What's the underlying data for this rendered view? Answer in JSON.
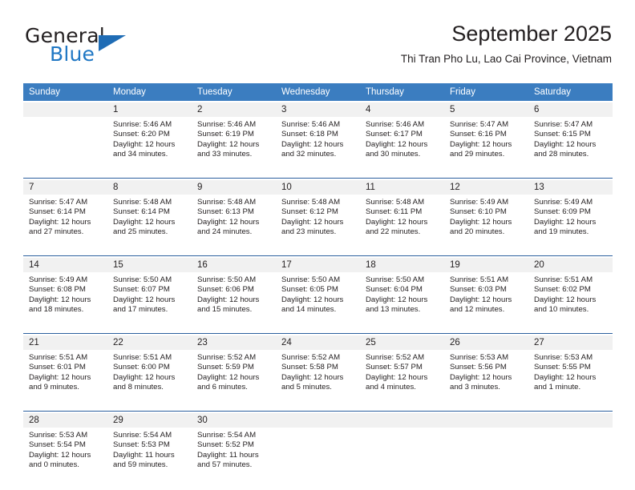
{
  "brand": {
    "name_top": "General",
    "name_bottom": "Blue",
    "triangle_color": "#1f6cb5",
    "blue_color": "#1f77c4"
  },
  "header": {
    "title": "September 2025",
    "subtitle": "Thi Tran Pho Lu, Lao Cai Province, Vietnam"
  },
  "theme": {
    "header_bg": "#3b7dc0",
    "daynum_bg": "#f1f1f1",
    "separator": "#2b5f9e",
    "text": "#231f20"
  },
  "calendar": {
    "weekday_headers": [
      "Sunday",
      "Monday",
      "Tuesday",
      "Wednesday",
      "Thursday",
      "Friday",
      "Saturday"
    ],
    "weeks": [
      {
        "days": [
          {
            "num": "",
            "sunrise": "",
            "sunset": "",
            "daylight1": "",
            "daylight2": ""
          },
          {
            "num": "1",
            "sunrise": "Sunrise: 5:46 AM",
            "sunset": "Sunset: 6:20 PM",
            "daylight1": "Daylight: 12 hours",
            "daylight2": "and 34 minutes."
          },
          {
            "num": "2",
            "sunrise": "Sunrise: 5:46 AM",
            "sunset": "Sunset: 6:19 PM",
            "daylight1": "Daylight: 12 hours",
            "daylight2": "and 33 minutes."
          },
          {
            "num": "3",
            "sunrise": "Sunrise: 5:46 AM",
            "sunset": "Sunset: 6:18 PM",
            "daylight1": "Daylight: 12 hours",
            "daylight2": "and 32 minutes."
          },
          {
            "num": "4",
            "sunrise": "Sunrise: 5:46 AM",
            "sunset": "Sunset: 6:17 PM",
            "daylight1": "Daylight: 12 hours",
            "daylight2": "and 30 minutes."
          },
          {
            "num": "5",
            "sunrise": "Sunrise: 5:47 AM",
            "sunset": "Sunset: 6:16 PM",
            "daylight1": "Daylight: 12 hours",
            "daylight2": "and 29 minutes."
          },
          {
            "num": "6",
            "sunrise": "Sunrise: 5:47 AM",
            "sunset": "Sunset: 6:15 PM",
            "daylight1": "Daylight: 12 hours",
            "daylight2": "and 28 minutes."
          }
        ]
      },
      {
        "days": [
          {
            "num": "7",
            "sunrise": "Sunrise: 5:47 AM",
            "sunset": "Sunset: 6:14 PM",
            "daylight1": "Daylight: 12 hours",
            "daylight2": "and 27 minutes."
          },
          {
            "num": "8",
            "sunrise": "Sunrise: 5:48 AM",
            "sunset": "Sunset: 6:14 PM",
            "daylight1": "Daylight: 12 hours",
            "daylight2": "and 25 minutes."
          },
          {
            "num": "9",
            "sunrise": "Sunrise: 5:48 AM",
            "sunset": "Sunset: 6:13 PM",
            "daylight1": "Daylight: 12 hours",
            "daylight2": "and 24 minutes."
          },
          {
            "num": "10",
            "sunrise": "Sunrise: 5:48 AM",
            "sunset": "Sunset: 6:12 PM",
            "daylight1": "Daylight: 12 hours",
            "daylight2": "and 23 minutes."
          },
          {
            "num": "11",
            "sunrise": "Sunrise: 5:48 AM",
            "sunset": "Sunset: 6:11 PM",
            "daylight1": "Daylight: 12 hours",
            "daylight2": "and 22 minutes."
          },
          {
            "num": "12",
            "sunrise": "Sunrise: 5:49 AM",
            "sunset": "Sunset: 6:10 PM",
            "daylight1": "Daylight: 12 hours",
            "daylight2": "and 20 minutes."
          },
          {
            "num": "13",
            "sunrise": "Sunrise: 5:49 AM",
            "sunset": "Sunset: 6:09 PM",
            "daylight1": "Daylight: 12 hours",
            "daylight2": "and 19 minutes."
          }
        ]
      },
      {
        "days": [
          {
            "num": "14",
            "sunrise": "Sunrise: 5:49 AM",
            "sunset": "Sunset: 6:08 PM",
            "daylight1": "Daylight: 12 hours",
            "daylight2": "and 18 minutes."
          },
          {
            "num": "15",
            "sunrise": "Sunrise: 5:50 AM",
            "sunset": "Sunset: 6:07 PM",
            "daylight1": "Daylight: 12 hours",
            "daylight2": "and 17 minutes."
          },
          {
            "num": "16",
            "sunrise": "Sunrise: 5:50 AM",
            "sunset": "Sunset: 6:06 PM",
            "daylight1": "Daylight: 12 hours",
            "daylight2": "and 15 minutes."
          },
          {
            "num": "17",
            "sunrise": "Sunrise: 5:50 AM",
            "sunset": "Sunset: 6:05 PM",
            "daylight1": "Daylight: 12 hours",
            "daylight2": "and 14 minutes."
          },
          {
            "num": "18",
            "sunrise": "Sunrise: 5:50 AM",
            "sunset": "Sunset: 6:04 PM",
            "daylight1": "Daylight: 12 hours",
            "daylight2": "and 13 minutes."
          },
          {
            "num": "19",
            "sunrise": "Sunrise: 5:51 AM",
            "sunset": "Sunset: 6:03 PM",
            "daylight1": "Daylight: 12 hours",
            "daylight2": "and 12 minutes."
          },
          {
            "num": "20",
            "sunrise": "Sunrise: 5:51 AM",
            "sunset": "Sunset: 6:02 PM",
            "daylight1": "Daylight: 12 hours",
            "daylight2": "and 10 minutes."
          }
        ]
      },
      {
        "days": [
          {
            "num": "21",
            "sunrise": "Sunrise: 5:51 AM",
            "sunset": "Sunset: 6:01 PM",
            "daylight1": "Daylight: 12 hours",
            "daylight2": "and 9 minutes."
          },
          {
            "num": "22",
            "sunrise": "Sunrise: 5:51 AM",
            "sunset": "Sunset: 6:00 PM",
            "daylight1": "Daylight: 12 hours",
            "daylight2": "and 8 minutes."
          },
          {
            "num": "23",
            "sunrise": "Sunrise: 5:52 AM",
            "sunset": "Sunset: 5:59 PM",
            "daylight1": "Daylight: 12 hours",
            "daylight2": "and 6 minutes."
          },
          {
            "num": "24",
            "sunrise": "Sunrise: 5:52 AM",
            "sunset": "Sunset: 5:58 PM",
            "daylight1": "Daylight: 12 hours",
            "daylight2": "and 5 minutes."
          },
          {
            "num": "25",
            "sunrise": "Sunrise: 5:52 AM",
            "sunset": "Sunset: 5:57 PM",
            "daylight1": "Daylight: 12 hours",
            "daylight2": "and 4 minutes."
          },
          {
            "num": "26",
            "sunrise": "Sunrise: 5:53 AM",
            "sunset": "Sunset: 5:56 PM",
            "daylight1": "Daylight: 12 hours",
            "daylight2": "and 3 minutes."
          },
          {
            "num": "27",
            "sunrise": "Sunrise: 5:53 AM",
            "sunset": "Sunset: 5:55 PM",
            "daylight1": "Daylight: 12 hours",
            "daylight2": "and 1 minute."
          }
        ]
      },
      {
        "days": [
          {
            "num": "28",
            "sunrise": "Sunrise: 5:53 AM",
            "sunset": "Sunset: 5:54 PM",
            "daylight1": "Daylight: 12 hours",
            "daylight2": "and 0 minutes."
          },
          {
            "num": "29",
            "sunrise": "Sunrise: 5:54 AM",
            "sunset": "Sunset: 5:53 PM",
            "daylight1": "Daylight: 11 hours",
            "daylight2": "and 59 minutes."
          },
          {
            "num": "30",
            "sunrise": "Sunrise: 5:54 AM",
            "sunset": "Sunset: 5:52 PM",
            "daylight1": "Daylight: 11 hours",
            "daylight2": "and 57 minutes."
          },
          {
            "num": "",
            "sunrise": "",
            "sunset": "",
            "daylight1": "",
            "daylight2": ""
          },
          {
            "num": "",
            "sunrise": "",
            "sunset": "",
            "daylight1": "",
            "daylight2": ""
          },
          {
            "num": "",
            "sunrise": "",
            "sunset": "",
            "daylight1": "",
            "daylight2": ""
          },
          {
            "num": "",
            "sunrise": "",
            "sunset": "",
            "daylight1": "",
            "daylight2": ""
          }
        ]
      }
    ]
  }
}
